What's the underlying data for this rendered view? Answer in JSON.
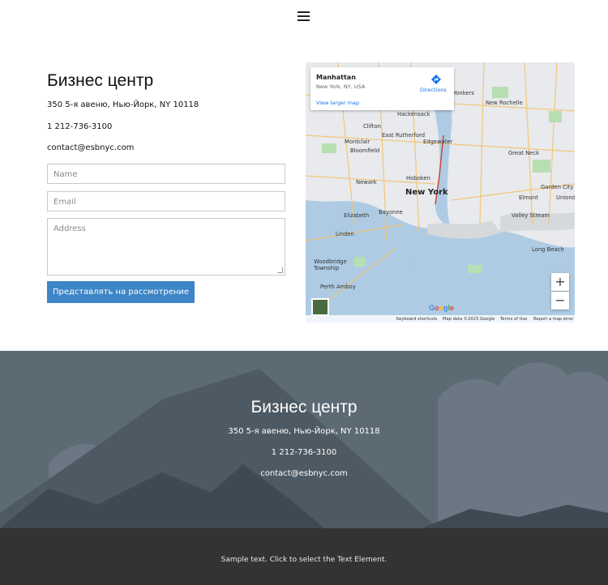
{
  "header": {
    "menu_icon": "hamburger-menu-icon"
  },
  "contact": {
    "title": "Бизнес центр",
    "address": "350 5-я авеню, Нью-Йорк, NY 10118",
    "phone": "1 212-736-3100",
    "email": "contact@esbnyc.com"
  },
  "form": {
    "name_placeholder": "Name",
    "email_placeholder": "Email",
    "address_placeholder": "Address",
    "submit_label": "Представлять на рассмотрение"
  },
  "map": {
    "place": "Manhattan",
    "place_address": "New York, NY, USA",
    "directions_label": "Directions",
    "larger_map_label": "View larger map",
    "zoom_in": "+",
    "zoom_out": "−",
    "google_logo": "Google",
    "attribution": {
      "shortcuts": "Keyboard shortcuts",
      "data": "Map data ©2023 Google",
      "terms": "Terms of Use",
      "report": "Report a map error"
    },
    "labels": {
      "yonkers": "Yonkers",
      "new_rochelle": "New Rochelle",
      "hackensack": "Hackensack",
      "clifton": "Clifton",
      "east_rutherford": "East Rutherford",
      "montclair": "Montclair",
      "bloomfield": "Bloomfield",
      "edgewater": "Edgewater",
      "great_neck": "Great Neck",
      "newark": "Newark",
      "hoboken": "Hoboken",
      "new_york": "New York",
      "garden_city": "Garden City",
      "elmont": "Elmont",
      "uniondale": "Uniondale",
      "elizabeth": "Elizabeth",
      "bayonne": "Bayonne",
      "valley_stream": "Valley Stream",
      "linden": "Linden",
      "long_beach": "Long Beach",
      "woodbridge": "Woodbridge Township",
      "perth_amboy": "Perth Amboy"
    }
  },
  "footer": {
    "title": "Бизнес центр",
    "address": "350 5-я авеню, Нью-Йорк, NY 10118",
    "phone": "1 212-736-3100",
    "email": "contact@esbnyc.com"
  },
  "bottom": {
    "text": "Sample text. Click to select the Text Element."
  },
  "colors": {
    "accent": "#3d85c6",
    "footer_bg": "#333333",
    "hero_bg": "#5c6a74"
  }
}
